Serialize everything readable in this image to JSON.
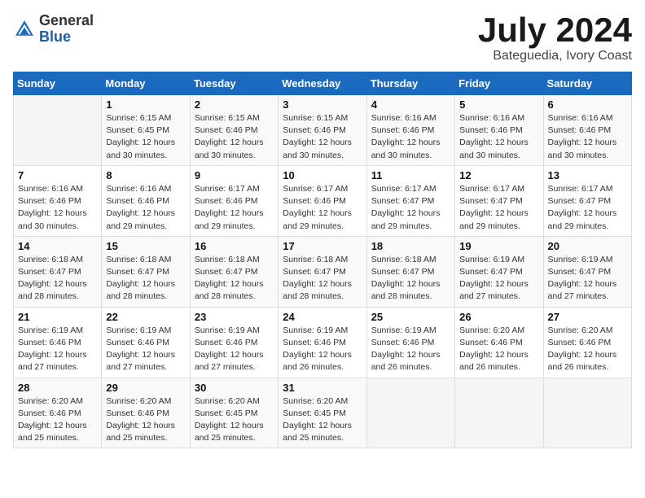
{
  "logo": {
    "general": "General",
    "blue": "Blue"
  },
  "title": {
    "month": "July 2024",
    "location": "Bateguedia, Ivory Coast"
  },
  "weekdays": [
    "Sunday",
    "Monday",
    "Tuesday",
    "Wednesday",
    "Thursday",
    "Friday",
    "Saturday"
  ],
  "weeks": [
    [
      {
        "day": "",
        "info": ""
      },
      {
        "day": "1",
        "info": "Sunrise: 6:15 AM\nSunset: 6:45 PM\nDaylight: 12 hours\nand 30 minutes."
      },
      {
        "day": "2",
        "info": "Sunrise: 6:15 AM\nSunset: 6:46 PM\nDaylight: 12 hours\nand 30 minutes."
      },
      {
        "day": "3",
        "info": "Sunrise: 6:15 AM\nSunset: 6:46 PM\nDaylight: 12 hours\nand 30 minutes."
      },
      {
        "day": "4",
        "info": "Sunrise: 6:16 AM\nSunset: 6:46 PM\nDaylight: 12 hours\nand 30 minutes."
      },
      {
        "day": "5",
        "info": "Sunrise: 6:16 AM\nSunset: 6:46 PM\nDaylight: 12 hours\nand 30 minutes."
      },
      {
        "day": "6",
        "info": "Sunrise: 6:16 AM\nSunset: 6:46 PM\nDaylight: 12 hours\nand 30 minutes."
      }
    ],
    [
      {
        "day": "7",
        "info": "Sunrise: 6:16 AM\nSunset: 6:46 PM\nDaylight: 12 hours\nand 30 minutes."
      },
      {
        "day": "8",
        "info": "Sunrise: 6:16 AM\nSunset: 6:46 PM\nDaylight: 12 hours\nand 29 minutes."
      },
      {
        "day": "9",
        "info": "Sunrise: 6:17 AM\nSunset: 6:46 PM\nDaylight: 12 hours\nand 29 minutes."
      },
      {
        "day": "10",
        "info": "Sunrise: 6:17 AM\nSunset: 6:46 PM\nDaylight: 12 hours\nand 29 minutes."
      },
      {
        "day": "11",
        "info": "Sunrise: 6:17 AM\nSunset: 6:47 PM\nDaylight: 12 hours\nand 29 minutes."
      },
      {
        "day": "12",
        "info": "Sunrise: 6:17 AM\nSunset: 6:47 PM\nDaylight: 12 hours\nand 29 minutes."
      },
      {
        "day": "13",
        "info": "Sunrise: 6:17 AM\nSunset: 6:47 PM\nDaylight: 12 hours\nand 29 minutes."
      }
    ],
    [
      {
        "day": "14",
        "info": "Sunrise: 6:18 AM\nSunset: 6:47 PM\nDaylight: 12 hours\nand 28 minutes."
      },
      {
        "day": "15",
        "info": "Sunrise: 6:18 AM\nSunset: 6:47 PM\nDaylight: 12 hours\nand 28 minutes."
      },
      {
        "day": "16",
        "info": "Sunrise: 6:18 AM\nSunset: 6:47 PM\nDaylight: 12 hours\nand 28 minutes."
      },
      {
        "day": "17",
        "info": "Sunrise: 6:18 AM\nSunset: 6:47 PM\nDaylight: 12 hours\nand 28 minutes."
      },
      {
        "day": "18",
        "info": "Sunrise: 6:18 AM\nSunset: 6:47 PM\nDaylight: 12 hours\nand 28 minutes."
      },
      {
        "day": "19",
        "info": "Sunrise: 6:19 AM\nSunset: 6:47 PM\nDaylight: 12 hours\nand 27 minutes."
      },
      {
        "day": "20",
        "info": "Sunrise: 6:19 AM\nSunset: 6:47 PM\nDaylight: 12 hours\nand 27 minutes."
      }
    ],
    [
      {
        "day": "21",
        "info": "Sunrise: 6:19 AM\nSunset: 6:46 PM\nDaylight: 12 hours\nand 27 minutes."
      },
      {
        "day": "22",
        "info": "Sunrise: 6:19 AM\nSunset: 6:46 PM\nDaylight: 12 hours\nand 27 minutes."
      },
      {
        "day": "23",
        "info": "Sunrise: 6:19 AM\nSunset: 6:46 PM\nDaylight: 12 hours\nand 27 minutes."
      },
      {
        "day": "24",
        "info": "Sunrise: 6:19 AM\nSunset: 6:46 PM\nDaylight: 12 hours\nand 26 minutes."
      },
      {
        "day": "25",
        "info": "Sunrise: 6:19 AM\nSunset: 6:46 PM\nDaylight: 12 hours\nand 26 minutes."
      },
      {
        "day": "26",
        "info": "Sunrise: 6:20 AM\nSunset: 6:46 PM\nDaylight: 12 hours\nand 26 minutes."
      },
      {
        "day": "27",
        "info": "Sunrise: 6:20 AM\nSunset: 6:46 PM\nDaylight: 12 hours\nand 26 minutes."
      }
    ],
    [
      {
        "day": "28",
        "info": "Sunrise: 6:20 AM\nSunset: 6:46 PM\nDaylight: 12 hours\nand 25 minutes."
      },
      {
        "day": "29",
        "info": "Sunrise: 6:20 AM\nSunset: 6:46 PM\nDaylight: 12 hours\nand 25 minutes."
      },
      {
        "day": "30",
        "info": "Sunrise: 6:20 AM\nSunset: 6:45 PM\nDaylight: 12 hours\nand 25 minutes."
      },
      {
        "day": "31",
        "info": "Sunrise: 6:20 AM\nSunset: 6:45 PM\nDaylight: 12 hours\nand 25 minutes."
      },
      {
        "day": "",
        "info": ""
      },
      {
        "day": "",
        "info": ""
      },
      {
        "day": "",
        "info": ""
      }
    ]
  ]
}
